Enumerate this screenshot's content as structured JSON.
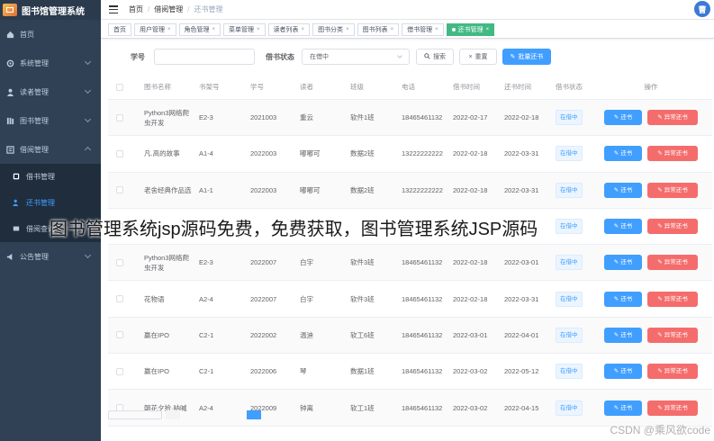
{
  "app": {
    "title": "图书馆管理系统",
    "avatar_text": "曹"
  },
  "sidebar": {
    "items": [
      {
        "label": "首页",
        "icon": "home-icon"
      },
      {
        "label": "系统管理",
        "icon": "gear-icon"
      },
      {
        "label": "读者管理",
        "icon": "user-icon"
      },
      {
        "label": "图书管理",
        "icon": "book-icon"
      },
      {
        "label": "借阅管理",
        "icon": "borrow-icon"
      }
    ],
    "submenu": [
      {
        "label": "借书管理",
        "active": false
      },
      {
        "label": "还书管理",
        "active": true
      },
      {
        "label": "借阅查询",
        "active": false
      }
    ],
    "last": {
      "label": "公告管理",
      "icon": "announce-icon"
    }
  },
  "breadcrumb": [
    "首页",
    "借阅管理",
    "还书管理"
  ],
  "tags": [
    {
      "label": "首页",
      "closable": false,
      "active": false
    },
    {
      "label": "用户管理",
      "closable": true,
      "active": false
    },
    {
      "label": "角色管理",
      "closable": true,
      "active": false
    },
    {
      "label": "菜单管理",
      "closable": true,
      "active": false
    },
    {
      "label": "读者列表",
      "closable": true,
      "active": false
    },
    {
      "label": "图书分类",
      "closable": true,
      "active": false
    },
    {
      "label": "图书列表",
      "closable": true,
      "active": false
    },
    {
      "label": "借书管理",
      "closable": true,
      "active": false
    },
    {
      "label": "还书管理",
      "closable": true,
      "active": true
    }
  ],
  "search": {
    "student_label": "学号",
    "student_value": "",
    "status_label": "借书状态",
    "status_value": "在借中",
    "search_btn": "搜索",
    "reset_btn": "重置",
    "batch_btn": "批量还书"
  },
  "table": {
    "headers": [
      "图书名称",
      "书架号",
      "学号",
      "读者",
      "班级",
      "电话",
      "借书时间",
      "还书时间",
      "借书状态",
      "操作"
    ],
    "return_btn": "还书",
    "abnormal_btn": "异常还书",
    "rows": [
      {
        "name": "Python3网络爬虫开发",
        "shelf": "E2-3",
        "sid": "2021003",
        "reader": "重云",
        "cls": "软件1班",
        "phone": "18465461132",
        "borrow": "2022-02-17",
        "ret": "2022-02-18",
        "status": "在借中"
      },
      {
        "name": "凡.高的故事",
        "shelf": "A1-4",
        "sid": "2022003",
        "reader": "嘟嘟可",
        "cls": "数据2班",
        "phone": "13222222222",
        "borrow": "2022-02-18",
        "ret": "2022-03-31",
        "status": "在借中"
      },
      {
        "name": "老舍经典作品选",
        "shelf": "A1-1",
        "sid": "2022003",
        "reader": "嘟嘟可",
        "cls": "数据2班",
        "phone": "13222222222",
        "borrow": "2022-02-18",
        "ret": "2022-03-31",
        "status": "在借中"
      },
      {
        "name": "",
        "shelf": "",
        "sid": "",
        "reader": "",
        "cls": "",
        "phone": "",
        "borrow": "",
        "ret": "",
        "status": "在借中"
      },
      {
        "name": "Python3网络爬虫开发",
        "shelf": "E2-3",
        "sid": "2022007",
        "reader": "白宇",
        "cls": "软件3班",
        "phone": "18465461132",
        "borrow": "2022-02-18",
        "ret": "2022-03-01",
        "status": "在借中"
      },
      {
        "name": "花物语",
        "shelf": "A2-4",
        "sid": "2022007",
        "reader": "白宇",
        "cls": "软件3班",
        "phone": "18465461132",
        "borrow": "2022-02-18",
        "ret": "2022-03-31",
        "status": "在借中"
      },
      {
        "name": "赢在IPO",
        "shelf": "C2-1",
        "sid": "2022002",
        "reader": "温迪",
        "cls": "软工6班",
        "phone": "18465461132",
        "borrow": "2022-03-01",
        "ret": "2022-04-01",
        "status": "在借中"
      },
      {
        "name": "赢在IPO",
        "shelf": "C2-1",
        "sid": "2022006",
        "reader": "琴",
        "cls": "数据1班",
        "phone": "18465461132",
        "borrow": "2022-03-02",
        "ret": "2022-05-12",
        "status": "在借中"
      },
      {
        "name": "朝花夕拾·呐喊",
        "shelf": "A2-4",
        "sid": "2022009",
        "reader": "钟离",
        "cls": "软工1班",
        "phone": "18465461132",
        "borrow": "2022-03-02",
        "ret": "2022-04-15",
        "status": "在借中"
      }
    ]
  },
  "overlay_text": "图书管理系统jsp源码免费，免费获取，图书管理系统JSP源码",
  "watermark": "CSDN @乘风欲code",
  "colors": {
    "sidebar_bg": "#304156",
    "primary": "#409eff",
    "danger": "#f56c6c",
    "active_tag": "#42b983"
  }
}
